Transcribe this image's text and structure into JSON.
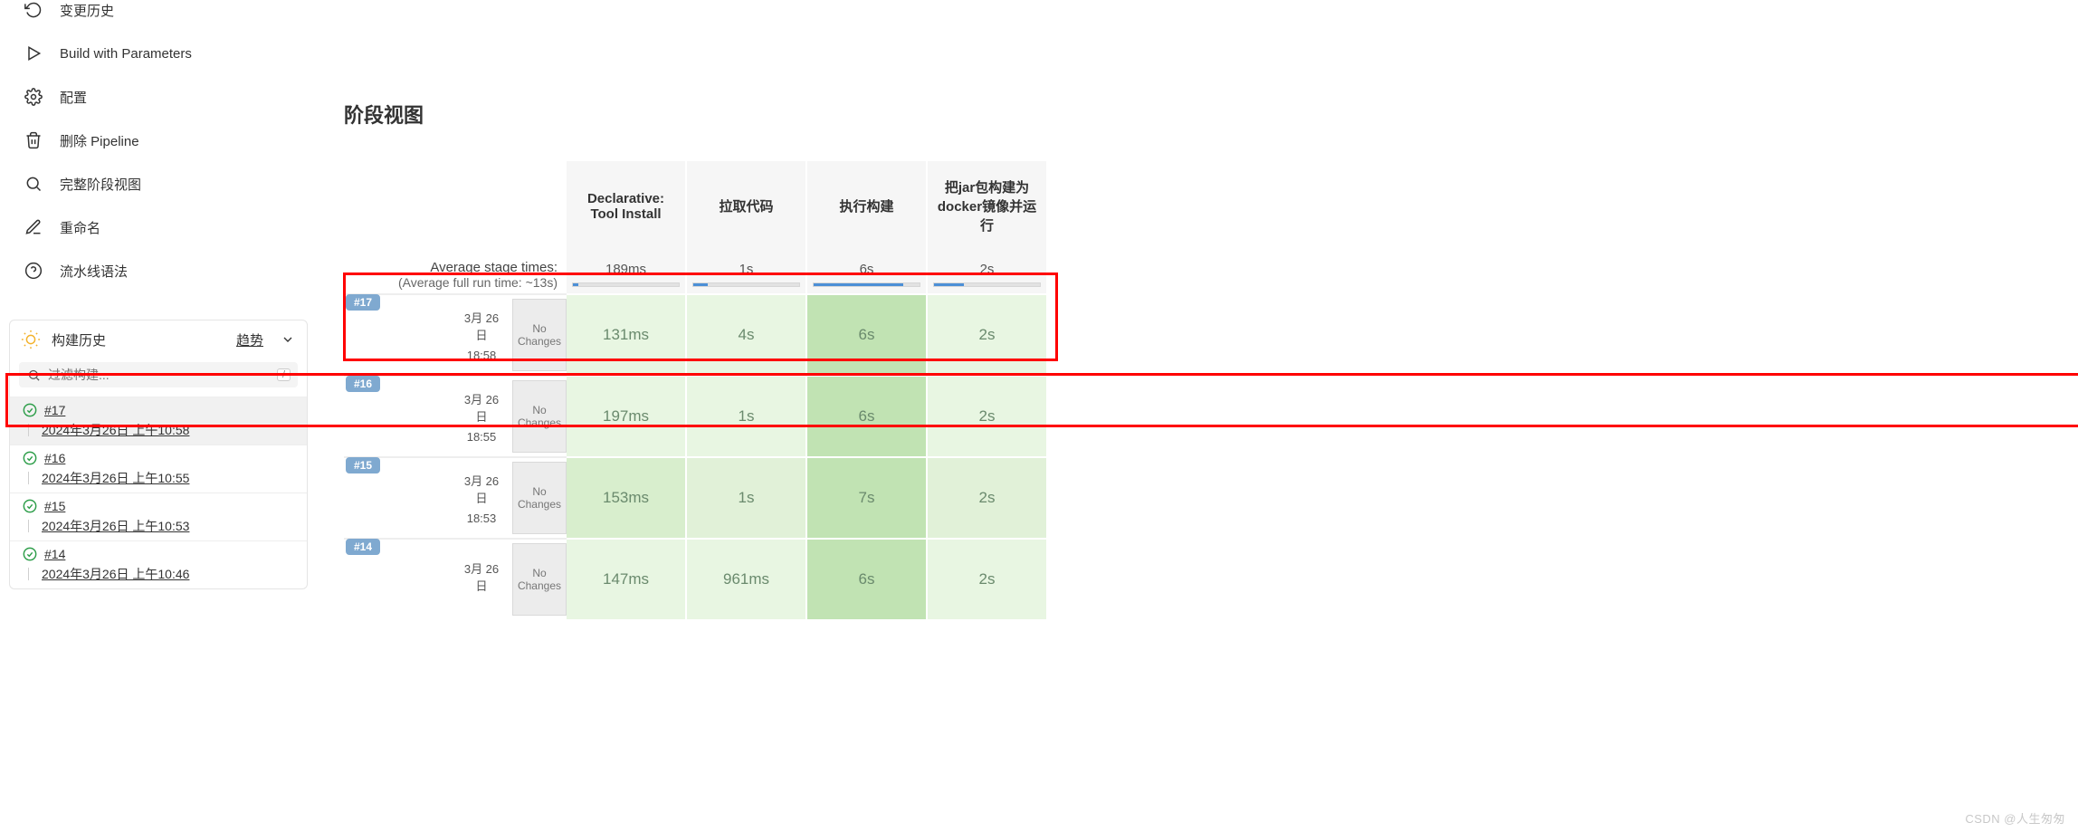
{
  "sidebar": {
    "menu": [
      {
        "name": "changes",
        "label": "变更历史"
      },
      {
        "name": "build",
        "label": "Build with Parameters"
      },
      {
        "name": "configure",
        "label": "配置"
      },
      {
        "name": "delete",
        "label": "删除 Pipeline"
      },
      {
        "name": "fullstage",
        "label": "完整阶段视图"
      },
      {
        "name": "rename",
        "label": "重命名"
      },
      {
        "name": "syntax",
        "label": "流水线语法"
      }
    ],
    "history": {
      "title": "构建历史",
      "trend_label": "趋势",
      "filter_placeholder": "过滤构建...",
      "slash_key": "/",
      "builds": [
        {
          "num": "#17",
          "date": "2024年3月26日 上午10:58",
          "active": true
        },
        {
          "num": "#16",
          "date": "2024年3月26日 上午10:55",
          "active": false
        },
        {
          "num": "#15",
          "date": "2024年3月26日 上午10:53",
          "active": false
        },
        {
          "num": "#14",
          "date": "2024年3月26日 上午10:46",
          "active": false
        }
      ]
    }
  },
  "main": {
    "title": "阶段视图",
    "avg_label": "Average stage times:",
    "avg_sub": "(Average full run time: ~13s)",
    "stages": [
      "Declarative: Tool Install",
      "拉取代码",
      "执行构建",
      "把jar包构建为docker镜像并运行"
    ],
    "averages": [
      {
        "text": "189ms",
        "pct": 5
      },
      {
        "text": "1s",
        "pct": 14
      },
      {
        "text": "6s",
        "pct": 85
      },
      {
        "text": "2s",
        "pct": 28
      }
    ],
    "runs": [
      {
        "badge": "#17",
        "date_top": "3月 26",
        "date_mid": "日",
        "time": "18:58",
        "changes_top": "No",
        "changes_bot": "Changes",
        "cells": [
          {
            "t": "131ms",
            "cls": "light"
          },
          {
            "t": "4s",
            "cls": "light"
          },
          {
            "t": "6s",
            "cls": "strong"
          },
          {
            "t": "2s",
            "cls": "light"
          }
        ]
      },
      {
        "badge": "#16",
        "date_top": "3月 26",
        "date_mid": "日",
        "time": "18:55",
        "changes_top": "No",
        "changes_bot": "Changes",
        "cells": [
          {
            "t": "197ms",
            "cls": "light"
          },
          {
            "t": "1s",
            "cls": "light"
          },
          {
            "t": "6s",
            "cls": "strong"
          },
          {
            "t": "2s",
            "cls": "light"
          }
        ]
      },
      {
        "badge": "#15",
        "date_top": "3月 26",
        "date_mid": "日",
        "time": "18:53",
        "changes_top": "No",
        "changes_bot": "Changes",
        "cells": [
          {
            "t": "153ms",
            "cls": "med"
          },
          {
            "t": "1s",
            "cls": "light2"
          },
          {
            "t": "7s",
            "cls": "strong"
          },
          {
            "t": "2s",
            "cls": "light2"
          }
        ]
      },
      {
        "badge": "#14",
        "date_top": "3月 26",
        "date_mid": "日",
        "time": "",
        "changes_top": "No",
        "changes_bot": "Changes",
        "cells": [
          {
            "t": "147ms",
            "cls": "light"
          },
          {
            "t": "961ms",
            "cls": "light"
          },
          {
            "t": "6s",
            "cls": "strong"
          },
          {
            "t": "2s",
            "cls": "light"
          }
        ]
      }
    ]
  },
  "watermark": "CSDN @人生匆匆"
}
